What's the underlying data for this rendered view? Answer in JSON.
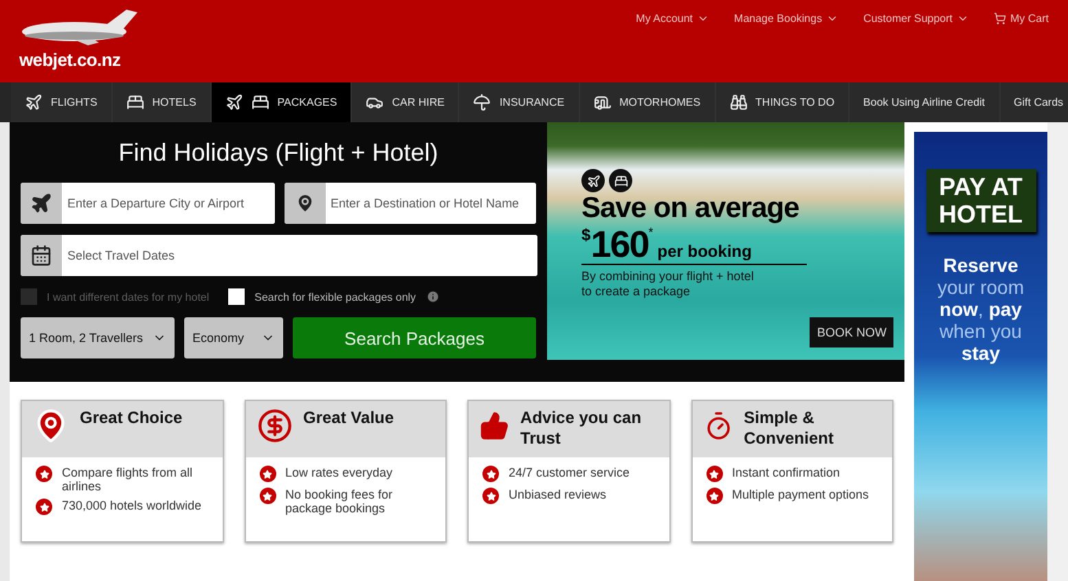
{
  "header": {
    "logo_text": "webjet.co.nz",
    "links": [
      {
        "label": "My Account",
        "kind": "menu"
      },
      {
        "label": "Manage Bookings",
        "kind": "menu"
      },
      {
        "label": "Customer Support",
        "kind": "menu"
      },
      {
        "label": "My Cart",
        "kind": "cart"
      }
    ]
  },
  "nav": [
    {
      "label": "FLIGHTS",
      "kind": "plane",
      "selected": false
    },
    {
      "label": "HOTELS",
      "kind": "bed",
      "selected": false
    },
    {
      "label": "PACKAGES",
      "kind": "package",
      "selected": true
    },
    {
      "label": "CAR HIRE",
      "kind": "car",
      "selected": false
    },
    {
      "label": "INSURANCE",
      "kind": "umbrella",
      "selected": false
    },
    {
      "label": "MOTORHOMES",
      "kind": "caravan",
      "selected": false
    },
    {
      "label": "THINGS TO DO",
      "kind": "binoculars",
      "selected": false
    },
    {
      "label": "Book Using Airline Credit",
      "kind": "text",
      "selected": false
    },
    {
      "label": "Gift Cards",
      "kind": "text",
      "selected": false
    }
  ],
  "search": {
    "title": "Find Holidays (Flight + Hotel)",
    "departure": {
      "placeholder": "Enter a Departure City or Airport"
    },
    "destination": {
      "placeholder": "Enter a Destination or Hotel Name"
    },
    "dates": {
      "placeholder": "Select Travel Dates"
    },
    "options": [
      {
        "label": "I want different dates for my hotel",
        "checked": false,
        "disabled": true,
        "kind": "plain"
      },
      {
        "label": "Search for flexible packages only",
        "checked": false,
        "disabled": false,
        "kind": "info"
      }
    ],
    "travellers": "1 Room, 2 Travellers",
    "cabin": "Economy",
    "button": "Search Packages"
  },
  "promo": {
    "headline": "Save on average",
    "currency": "$",
    "amount": "160",
    "mark": "*",
    "per": "per booking",
    "subtext": "By combining your flight + hotel to create a package",
    "button": "BOOK NOW"
  },
  "features": [
    {
      "kind": "choice",
      "title": "Great Choice",
      "points": [
        "Compare flights from all airlines",
        "730,000 hotels worldwide"
      ]
    },
    {
      "kind": "value",
      "title": "Great Value",
      "points": [
        "Low rates everyday",
        "No booking fees for package bookings"
      ]
    },
    {
      "kind": "trust",
      "title": "Advice you can Trust",
      "points": [
        "24/7 customer service",
        "Unbiased reviews"
      ]
    },
    {
      "kind": "speed",
      "title": "Simple & Convenient",
      "points": [
        "Instant confirmation",
        "Multiple payment options"
      ]
    }
  ],
  "ad": {
    "badge": "PAY AT HOTEL",
    "text": "**Reserve** your room **now**, **pay** when you **stay**"
  }
}
